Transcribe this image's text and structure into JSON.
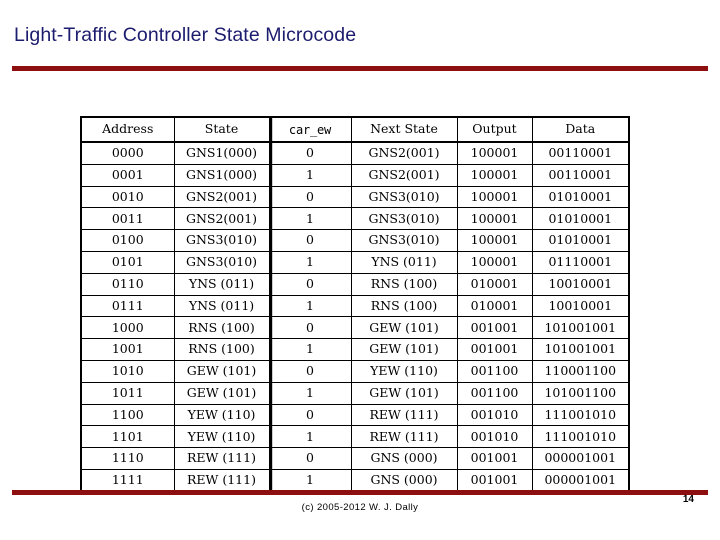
{
  "slide": {
    "title": "Light-Traffic Controller State Microcode",
    "title_color": "#1c1c6e",
    "rule_color": "#8e0f0f"
  },
  "footer": {
    "copyright": "(c) 2005-2012 W. J. Dally",
    "page_number": "14"
  },
  "table": {
    "headers": [
      "Address",
      "State",
      "car_ew",
      "Next State",
      "Output",
      "Data"
    ],
    "rows": [
      {
        "address": "0000",
        "state": "GNS1(000)",
        "car_ew": "0",
        "next_state": "GNS2(001)",
        "output": "100001",
        "data": "00110001"
      },
      {
        "address": "0001",
        "state": "GNS1(000)",
        "car_ew": "1",
        "next_state": "GNS2(001)",
        "output": "100001",
        "data": "00110001"
      },
      {
        "address": "0010",
        "state": "GNS2(001)",
        "car_ew": "0",
        "next_state": "GNS3(010)",
        "output": "100001",
        "data": "01010001"
      },
      {
        "address": "0011",
        "state": "GNS2(001)",
        "car_ew": "1",
        "next_state": "GNS3(010)",
        "output": "100001",
        "data": "01010001"
      },
      {
        "address": "0100",
        "state": "GNS3(010)",
        "car_ew": "0",
        "next_state": "GNS3(010)",
        "output": "100001",
        "data": "01010001"
      },
      {
        "address": "0101",
        "state": "GNS3(010)",
        "car_ew": "1",
        "next_state": "YNS (011)",
        "output": "100001",
        "data": "01110001"
      },
      {
        "address": "0110",
        "state": "YNS (011)",
        "car_ew": "0",
        "next_state": "RNS (100)",
        "output": "010001",
        "data": "10010001"
      },
      {
        "address": "0111",
        "state": "YNS (011)",
        "car_ew": "1",
        "next_state": "RNS (100)",
        "output": "010001",
        "data": "10010001"
      },
      {
        "address": "1000",
        "state": "RNS (100)",
        "car_ew": "0",
        "next_state": "GEW (101)",
        "output": "001001",
        "data": "101001001"
      },
      {
        "address": "1001",
        "state": "RNS (100)",
        "car_ew": "1",
        "next_state": "GEW (101)",
        "output": "001001",
        "data": "101001001"
      },
      {
        "address": "1010",
        "state": "GEW (101)",
        "car_ew": "0",
        "next_state": "YEW (110)",
        "output": "001100",
        "data": "110001100"
      },
      {
        "address": "1011",
        "state": "GEW (101)",
        "car_ew": "1",
        "next_state": "GEW (101)",
        "output": "001100",
        "data": "101001100"
      },
      {
        "address": "1100",
        "state": "YEW (110)",
        "car_ew": "0",
        "next_state": "REW (111)",
        "output": "001010",
        "data": "111001010"
      },
      {
        "address": "1101",
        "state": "YEW (110)",
        "car_ew": "1",
        "next_state": "REW (111)",
        "output": "001010",
        "data": "111001010"
      },
      {
        "address": "1110",
        "state": "REW (111)",
        "car_ew": "0",
        "next_state": "GNS (000)",
        "output": "001001",
        "data": "000001001"
      },
      {
        "address": "1111",
        "state": "REW (111)",
        "car_ew": "1",
        "next_state": "GNS (000)",
        "output": "001001",
        "data": "000001001"
      }
    ]
  }
}
